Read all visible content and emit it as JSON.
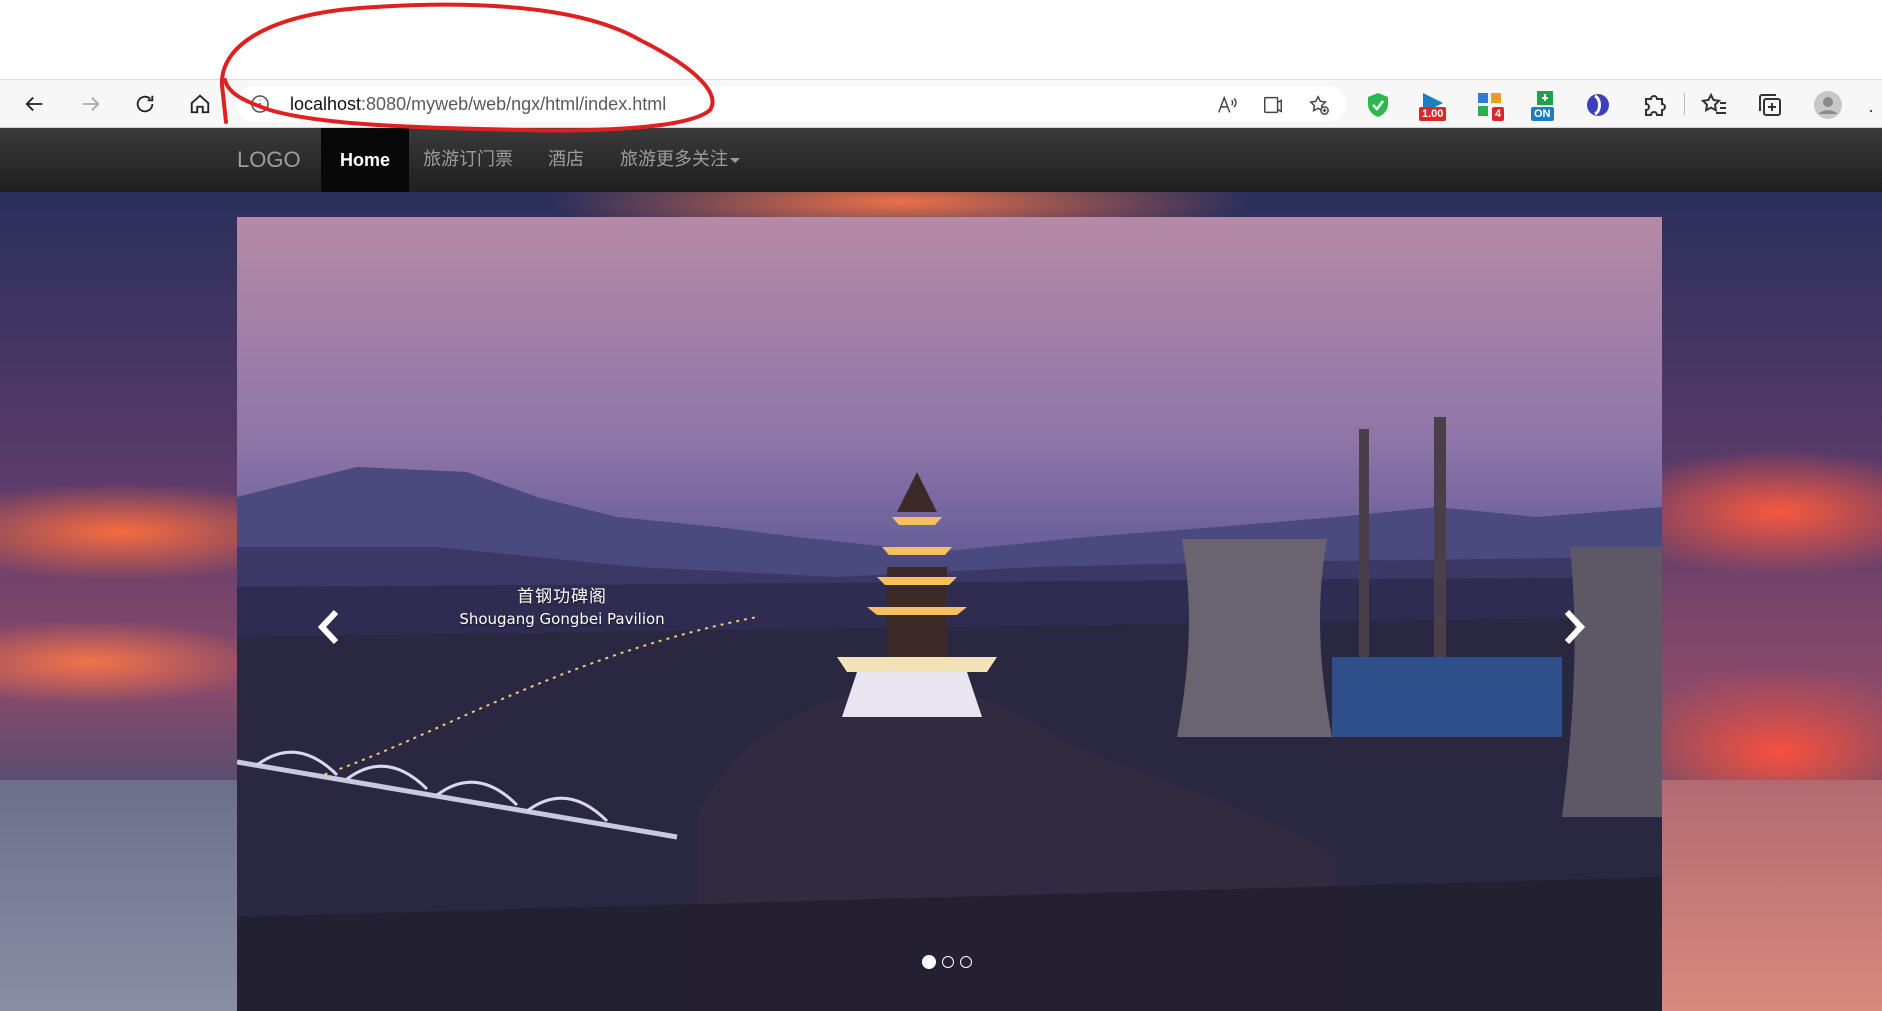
{
  "browser": {
    "url_host": "localhost",
    "url_rest": ":8080/myweb/web/ngx/html/index.html",
    "extensions": [
      {
        "name": "adguard-shield-icon"
      },
      {
        "name": "extension-badge-1",
        "badge": "1.00"
      },
      {
        "name": "extension-badge-2",
        "badge": "4"
      },
      {
        "name": "extension-badge-3",
        "badge": "ON"
      }
    ]
  },
  "nav": {
    "logo": "LOGO",
    "items": [
      {
        "label": "Home",
        "active": true
      },
      {
        "label": "旅游订门票"
      },
      {
        "label": "酒店"
      },
      {
        "label": "旅游更多关注"
      }
    ]
  },
  "carousel": {
    "caption_cn": "首钢功碑阁",
    "caption_en": "Shougang Gongbei Pavilion",
    "slide_count": 3,
    "active_index": 0
  },
  "colors": {
    "annotation": "#e02020",
    "navbar": "#222222",
    "nav_active": "#080808",
    "nav_text": "#9d9d9d"
  }
}
